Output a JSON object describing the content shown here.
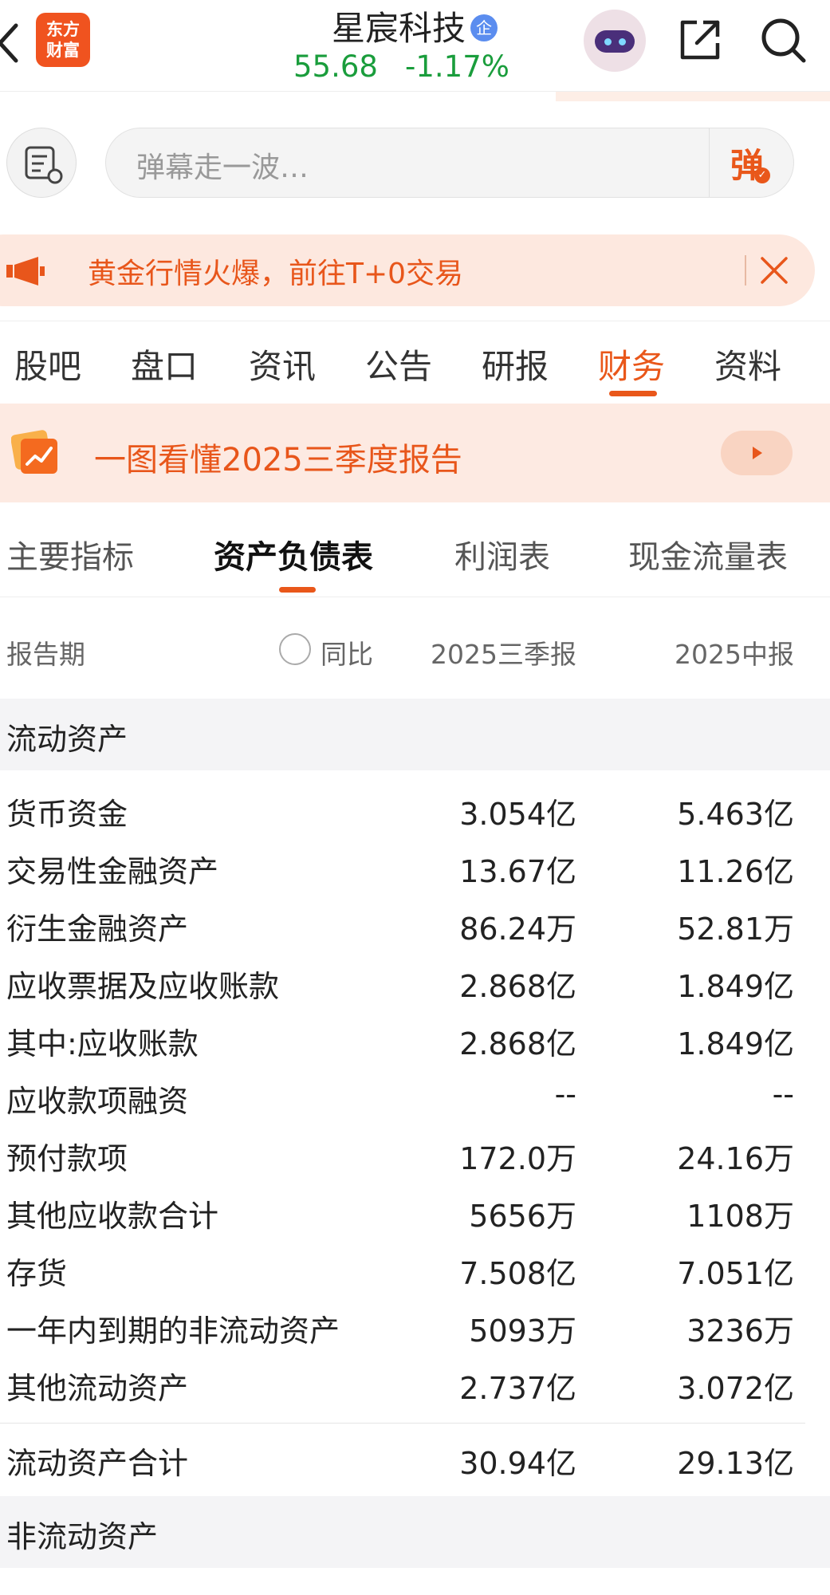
{
  "header": {
    "logo_line1": "东方",
    "logo_line2": "财富",
    "stock_name": "星宸科技",
    "badge": "企",
    "price": "55.68",
    "change_pct": "-1.17%"
  },
  "danmu": {
    "placeholder": "弹幕走一波…",
    "button_label": "弹"
  },
  "promo": {
    "text": "黄金行情火爆，前往T+0交易"
  },
  "nav_tabs": [
    {
      "label": "股吧",
      "active": false
    },
    {
      "label": "盘口",
      "active": false
    },
    {
      "label": "资讯",
      "active": false
    },
    {
      "label": "公告",
      "active": false
    },
    {
      "label": "研报",
      "active": false
    },
    {
      "label": "财务",
      "active": true
    },
    {
      "label": "资料",
      "active": false
    }
  ],
  "banner": {
    "text": "一图看懂2025三季度报告"
  },
  "sub_tabs": [
    {
      "label": "主要指标",
      "active": false
    },
    {
      "label": "资产负债表",
      "active": true
    },
    {
      "label": "利润表",
      "active": false
    },
    {
      "label": "现金流量表",
      "active": false
    }
  ],
  "table_header": {
    "period_label": "报告期",
    "yoy_label": "同比",
    "col1": "2025三季报",
    "col2": "2025中报"
  },
  "sections": {
    "current_assets": "流动资产",
    "non_current_assets": "非流动资产"
  },
  "rows": [
    {
      "label": "货币资金",
      "v1": "3.054亿",
      "v2": "5.463亿"
    },
    {
      "label": "交易性金融资产",
      "v1": "13.67亿",
      "v2": "11.26亿"
    },
    {
      "label": "衍生金融资产",
      "v1": "86.24万",
      "v2": "52.81万"
    },
    {
      "label": "应收票据及应收账款",
      "v1": "2.868亿",
      "v2": "1.849亿"
    },
    {
      "label": "其中:应收账款",
      "v1": "2.868亿",
      "v2": "1.849亿"
    },
    {
      "label": "应收款项融资",
      "v1": "--",
      "v2": "--"
    },
    {
      "label": "预付款项",
      "v1": "172.0万",
      "v2": "24.16万"
    },
    {
      "label": "其他应收款合计",
      "v1": "5656万",
      "v2": "1108万"
    },
    {
      "label": "存货",
      "v1": "7.508亿",
      "v2": "7.051亿"
    },
    {
      "label": "一年内到期的非流动资产",
      "v1": "5093万",
      "v2": "3236万"
    },
    {
      "label": "其他流动资产",
      "v1": "2.737亿",
      "v2": "3.072亿"
    }
  ],
  "total_row": {
    "label": "流动资产合计",
    "v1": "30.94亿",
    "v2": "29.13亿"
  },
  "colors": {
    "accent": "#e9571a",
    "price_down": "#1a9d3c",
    "promo_bg": "#fde8df"
  }
}
